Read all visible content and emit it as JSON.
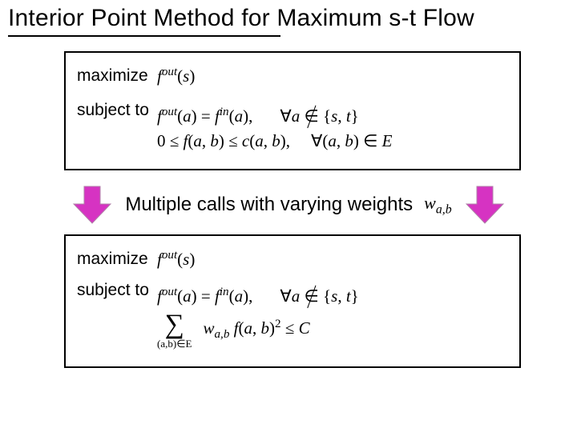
{
  "title": "Interior Point Method for Maximum s-t Flow",
  "box1": {
    "maximize_label": "maximize",
    "subject_label": "subject to",
    "objective_html": "<span class='i'>f</span><span class='sup'>out</span>(<span class='i'>s</span>)",
    "conservation_html": "<span class='i'>f</span><span class='sup'>out</span>(<span class='i'>a</span>) = <span class='i'>f</span><span class='sup'>in</span>(<span class='i'>a</span>),",
    "conservation_forall_html": "∀<span class='i'>a</span> <span class='notin'>∈</span> {<span class='i'>s</span>, <span class='i'>t</span>}",
    "capacity_html": "0 ≤ <span class='i'>f</span>(<span class='i'>a</span>, <span class='i'>b</span>) ≤ <span class='i'>c</span>(<span class='i'>a</span>, <span class='i'>b</span>),",
    "capacity_forall_html": "∀(<span class='i'>a</span>, <span class='i'>b</span>) ∈ <span class='i'>E</span>"
  },
  "center": {
    "text": "Multiple calls with varying weights",
    "weight_html": "<span class='i'>w</span><span class='wab-sub'>a,b</span>"
  },
  "box2": {
    "maximize_label": "maximize",
    "subject_label": "subject to",
    "objective_html": "<span class='i'>f</span><span class='sup'>out</span>(<span class='i'>s</span>)",
    "conservation_html": "<span class='i'>f</span><span class='sup'>out</span>(<span class='i'>a</span>) = <span class='i'>f</span><span class='sup'>in</span>(<span class='i'>a</span>),",
    "conservation_forall_html": "∀<span class='i'>a</span> <span class='notin'>∈</span> {<span class='i'>s</span>, <span class='i'>t</span>}",
    "sum_sub_html": "(<span class='i'>a</span>,<span class='i'>b</span>)∈<span class='i'>E</span>",
    "sum_body_html": "<span class='i'>w</span><span class='wab-sub'>a,b</span> <span class='i'>f</span>(<span class='i'>a</span>, <span class='i'>b</span>)<span class='sup' style='font-style:normal;'>2</span> ≤ <span class='i'>C</span>"
  },
  "arrow": {
    "fill": "#d633c2",
    "stroke": "#b080a8"
  }
}
